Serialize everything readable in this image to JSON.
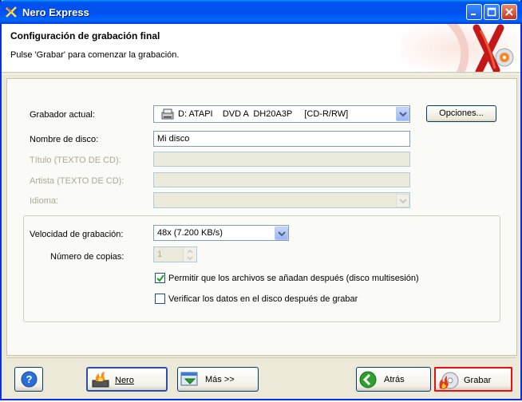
{
  "window": {
    "title": "Nero Express"
  },
  "header": {
    "title": "Configuración de grabación final",
    "subtitle": "Pulse 'Grabar' para comenzar la grabación."
  },
  "form": {
    "recorder_label": "Grabador actual:",
    "recorder_value": "D: ATAPI    DVD A  DH20A3P     [CD-R/RW]",
    "options_button": "Opciones...",
    "disc_name_label": "Nombre de disco:",
    "disc_name_value": "Mi disco",
    "title_label": "Título (TEXTO DE CD):",
    "artist_label": "Artista (TEXTO DE CD):",
    "language_label": "Idioma:"
  },
  "burn": {
    "speed_label": "Velocidad de grabación:",
    "speed_value": "48x (7.200 KB/s)",
    "copies_label": "Número de copias:",
    "copies_value": "1",
    "multisession_label": "Permitir que los archivos se añadan después (disco multisesión)",
    "multisession_checked": true,
    "verify_label": "Verificar los datos en el disco después de grabar",
    "verify_checked": false
  },
  "footer": {
    "help_icon": "question-icon",
    "nero_label": "Nero",
    "more_label": "Más >>",
    "back_label": "Atrás",
    "burn_label": "Grabar"
  },
  "colors": {
    "title_bar": "#0050ee",
    "accent_red": "#d42020",
    "highlight_border": "#e81010"
  }
}
